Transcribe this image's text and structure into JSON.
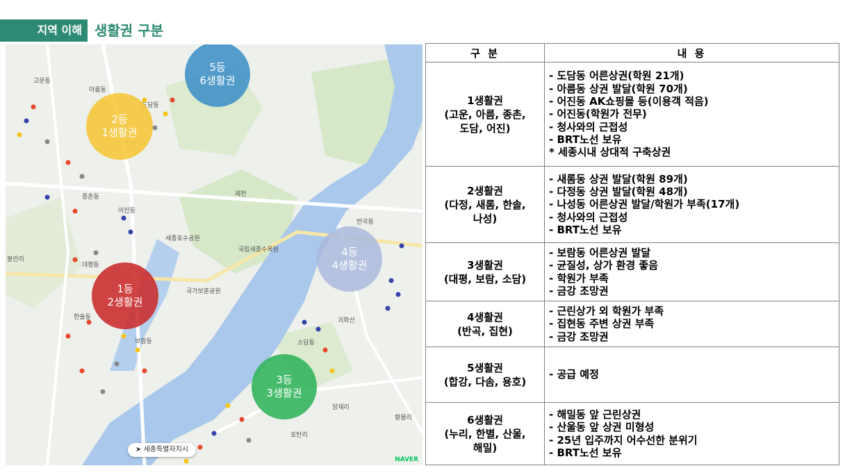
{
  "header": {
    "section": "지역 이해",
    "title": "생활권 구분"
  },
  "map": {
    "labels": {
      "l1": "고운동",
      "l2": "아름동",
      "l3": "종촌동",
      "l4": "어진동",
      "l5": "도담동",
      "l6": "대평동",
      "l7": "보람동",
      "l8": "소담동",
      "l9": "반곡동",
      "l10": "한솔동",
      "l11": "괴화산",
      "l12": "장재리",
      "l13": "호탄리",
      "l14": "황용리",
      "l15": "봉안리",
      "l16": "국가보훈공원",
      "l17": "제천",
      "l18": "세종호수공원",
      "l19": "국립세종수목원"
    },
    "circles": [
      {
        "rank": "5등",
        "zone": "6생활권",
        "color": "#3d8fc7"
      },
      {
        "rank": "2등",
        "zone": "1생활권",
        "color": "#f4c430"
      },
      {
        "rank": "4등",
        "zone": "4생활권",
        "color": "#a9b9dd"
      },
      {
        "rank": "1등",
        "zone": "2생활권",
        "color": "#c92a2a"
      },
      {
        "rank": "3등",
        "zone": "3생활권",
        "color": "#2fb35a"
      }
    ],
    "badge": "세종특별자치시",
    "brand": "NAVER"
  },
  "table": {
    "headers": [
      "구 분",
      "내 용"
    ],
    "rows": [
      {
        "name": [
          "1생활권",
          "(고운, 아름, 종촌,",
          "도담, 어진)"
        ],
        "items": [
          "- 도담동 어른상권(학원 21개)",
          "- 아름동 상권 발달(학원 70개)",
          "- 어진동 AK쇼핑몰 등(이용객 적음)",
          "- 어진동(학원가 전무)",
          "- 청사와의 근접성",
          "- BRT노선 보유",
          "* 세종시내 상대적 구축상권"
        ]
      },
      {
        "name": [
          "2생활권",
          "(다정, 새롬, 한솔,",
          "나성)"
        ],
        "items": [
          "- 새롬동 상권 발달(학원 89개)",
          "- 다정동 상권 발달(학원 48개)",
          "- 나성동 어른상권 발달/학원가 부족(17개)",
          "- 청사와의 근접성",
          "- BRT노선 보유"
        ]
      },
      {
        "name": [
          "3생활권",
          "(대평, 보람, 소담)"
        ],
        "items": [
          "- 보람동 어른상권 발달",
          "- 균질성, 상가 환경 좋음",
          "- 학원가 부족",
          "- 금강 조망권"
        ]
      },
      {
        "name": [
          "4생활권",
          "(반곡, 집현)"
        ],
        "items": [
          "- 근린상가 외 학원가 부족",
          "- 집현동 주변 상권 부족",
          "- 금강 조망권"
        ]
      },
      {
        "name": [
          "5생활권",
          "(합강, 다솜, 용호)"
        ],
        "items": [
          "- 공급 예정"
        ]
      },
      {
        "name": [
          "6생활권",
          "(누리, 한별, 산울,",
          "해밀)"
        ],
        "items": [
          "- 해밀동 앞 근린상권",
          "- 산울동 앞 상권 미형성",
          "- 25년 입주까지 어수선한 분위기",
          "- BRT노선 보유"
        ]
      }
    ]
  }
}
